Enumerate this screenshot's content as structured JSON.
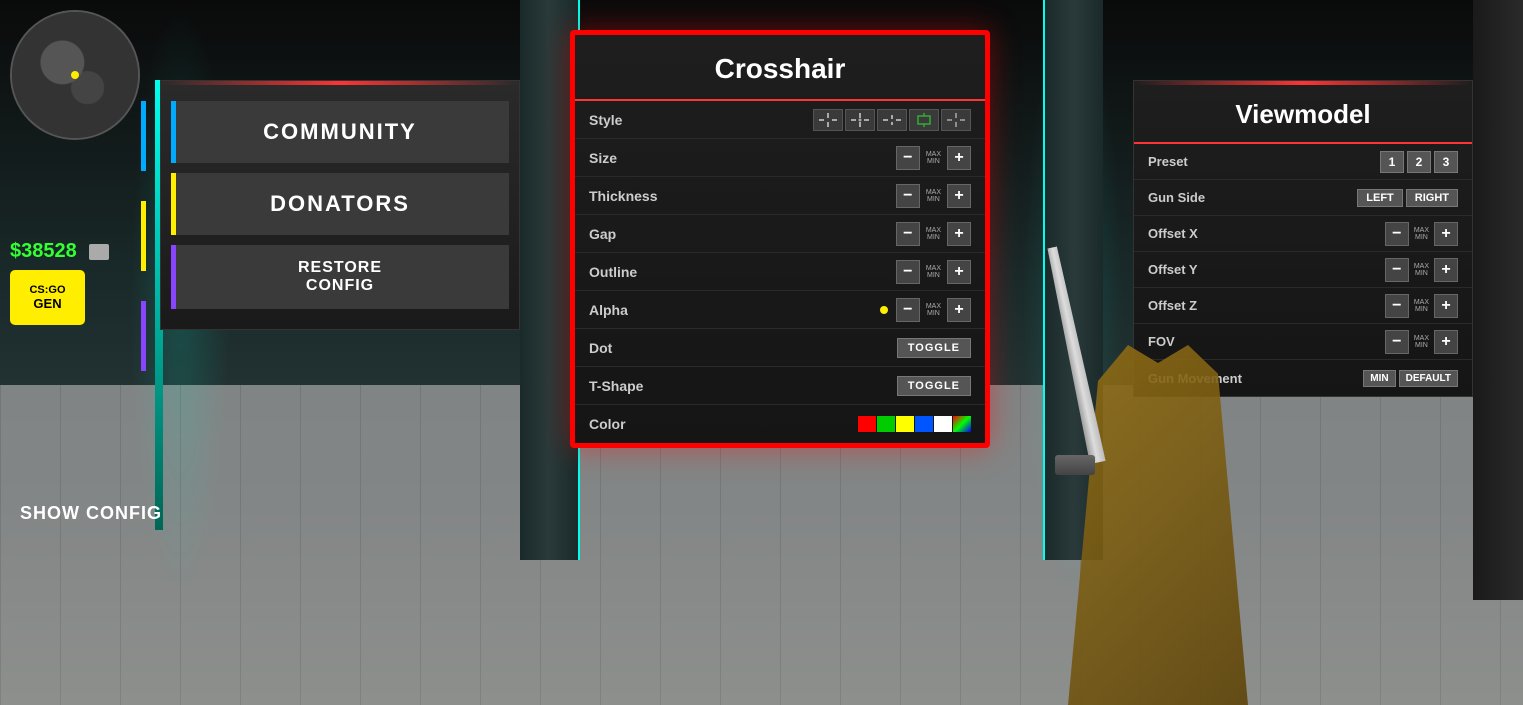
{
  "scene": {
    "background_color": "#1a1a1a"
  },
  "hud": {
    "money": "$38528",
    "logo_line1": "CS:GO",
    "logo_line2": "GEN"
  },
  "left_panel": {
    "buttons": [
      {
        "id": "community",
        "label": "COMMUNITY",
        "accent_color": "#00aaff"
      },
      {
        "id": "donators",
        "label": "DONATORS",
        "accent_color": "#ffee00"
      },
      {
        "id": "restore",
        "label": "RESTORE\nCONFIG",
        "accent_color": "#8844ff"
      }
    ],
    "show_config_label": "SHOW\nCONFIG"
  },
  "crosshair_panel": {
    "title": "Crosshair",
    "border_color": "#ff0000",
    "rows": [
      {
        "id": "style",
        "label": "Style",
        "control_type": "style_icons",
        "icon_count": 5
      },
      {
        "id": "size",
        "label": "Size",
        "control_type": "stepper",
        "max_label": "MAX",
        "min_label": "MIN"
      },
      {
        "id": "thickness",
        "label": "Thickness",
        "control_type": "stepper",
        "max_label": "MAX",
        "min_label": "MIN"
      },
      {
        "id": "gap",
        "label": "Gap",
        "control_type": "stepper",
        "max_label": "MAX",
        "min_label": "MIN"
      },
      {
        "id": "outline",
        "label": "Outline",
        "control_type": "stepper",
        "max_label": "MAX",
        "min_label": "MIN"
      },
      {
        "id": "alpha",
        "label": "Alpha",
        "control_type": "stepper_with_dot",
        "max_label": "MAX",
        "min_label": "MIN"
      },
      {
        "id": "dot",
        "label": "Dot",
        "control_type": "toggle",
        "toggle_label": "TOGGLE"
      },
      {
        "id": "tshape",
        "label": "T-Shape",
        "control_type": "toggle",
        "toggle_label": "TOGGLE"
      },
      {
        "id": "color",
        "label": "Color",
        "control_type": "color_swatches",
        "swatches": [
          "#ff0000",
          "#00cc00",
          "#0000ff",
          "#ffff00",
          "#ff00ff",
          "#ffffff"
        ]
      }
    ]
  },
  "viewmodel_panel": {
    "title": "Viewmodel",
    "rows": [
      {
        "id": "preset",
        "label": "Preset",
        "control_type": "preset_buttons",
        "presets": [
          "1",
          "2",
          "3"
        ]
      },
      {
        "id": "gun_side",
        "label": "Gun Side",
        "control_type": "side_buttons",
        "options": [
          "LEFT",
          "RIGHT"
        ]
      },
      {
        "id": "offset_x",
        "label": "Offset X",
        "control_type": "stepper",
        "max_label": "MAX",
        "min_label": "MIN"
      },
      {
        "id": "offset_y",
        "label": "Offset Y",
        "control_type": "stepper",
        "max_label": "MAX",
        "min_label": "MIN"
      },
      {
        "id": "offset_z",
        "label": "Offset Z",
        "control_type": "stepper",
        "max_label": "MAX",
        "min_label": "MIN"
      },
      {
        "id": "fov",
        "label": "FOV",
        "control_type": "stepper",
        "max_label": "MAX",
        "min_label": "MIN"
      },
      {
        "id": "gun_movement",
        "label": "Gun Movement",
        "control_type": "min_default_buttons",
        "options": [
          "MIN",
          "DEFAULT"
        ]
      }
    ]
  }
}
